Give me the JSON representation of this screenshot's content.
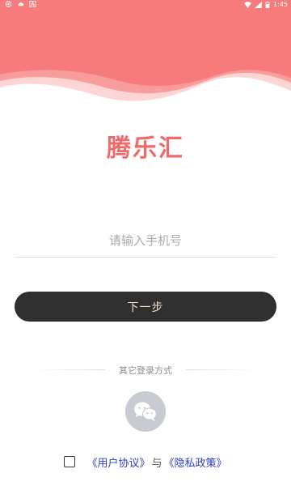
{
  "status_bar": {
    "time": "1:45",
    "left_icons": [
      "app-notification-icon",
      "cloud-icon",
      "app-a-icon"
    ],
    "right_icons": [
      "wifi-icon",
      "signal-icon",
      "battery-icon"
    ]
  },
  "brand": {
    "logo_text": "腾乐汇",
    "hero_color": "#f77b7b",
    "logo_color": "#ef6a6a"
  },
  "login_form": {
    "phone_placeholder": "请输入手机号",
    "phone_value": "",
    "next_button_label": "下一步",
    "button_color": "#2f2f2f"
  },
  "other_login": {
    "label": "其它登录方式",
    "wechat_icon": "wechat-icon"
  },
  "agreement": {
    "checked": false,
    "user_agreement_link": "《用户协议》",
    "joiner": "与",
    "privacy_policy_link": "《隐私政策》",
    "link_color": "#2b3fc4"
  }
}
